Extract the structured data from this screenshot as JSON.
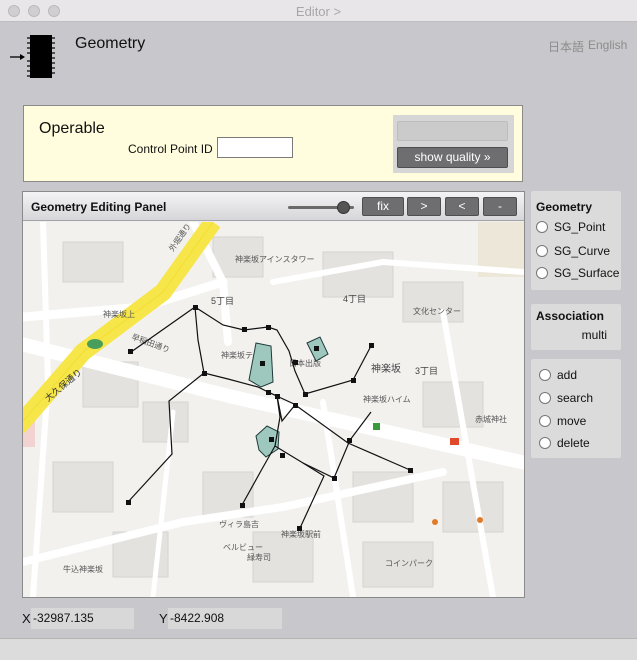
{
  "window": {
    "title": "Editor >"
  },
  "app": {
    "title": "Geometry"
  },
  "languages": [
    "日本語",
    "English"
  ],
  "operable": {
    "title": "Operable",
    "control_point_label": "Control Point ID",
    "control_point_value": "",
    "show_quality_label": "show quality »"
  },
  "panel": {
    "title": "Geometry Editing Panel",
    "buttons": [
      "fix",
      ">",
      "<",
      "-"
    ],
    "zoom_fraction": 0.84
  },
  "map_labels": [
    "神楽坂上",
    "早稲田通り",
    "大久保通り",
    "外堀通り",
    "5丁目",
    "4丁目",
    "3丁目",
    "神楽坂",
    "神楽坂テラス",
    "日本出版",
    "神楽坂ハイム",
    "コインパーク",
    "ベルビュー",
    "緑寿司",
    "ヴィラ島吉",
    "神楽坂駅前",
    "文化センター",
    "牛込神楽坂",
    "赤城神社",
    "神楽坂アインスタワー"
  ],
  "geometry": {
    "title": "Geometry",
    "options": [
      "SG_Point",
      "SG_Curve",
      "SG_Surface"
    ]
  },
  "association": {
    "title": "Association",
    "value": "multi"
  },
  "actions": [
    "add",
    "search",
    "move",
    "delete"
  ],
  "coords": {
    "x_label": "X",
    "x_value": "-32987.135",
    "y_label": "Y",
    "y_value": "-8422.908"
  },
  "colors": {
    "operable_bg": "#fffddd",
    "button": "#6e6e70",
    "surface_fill": "#9ec8bd"
  }
}
